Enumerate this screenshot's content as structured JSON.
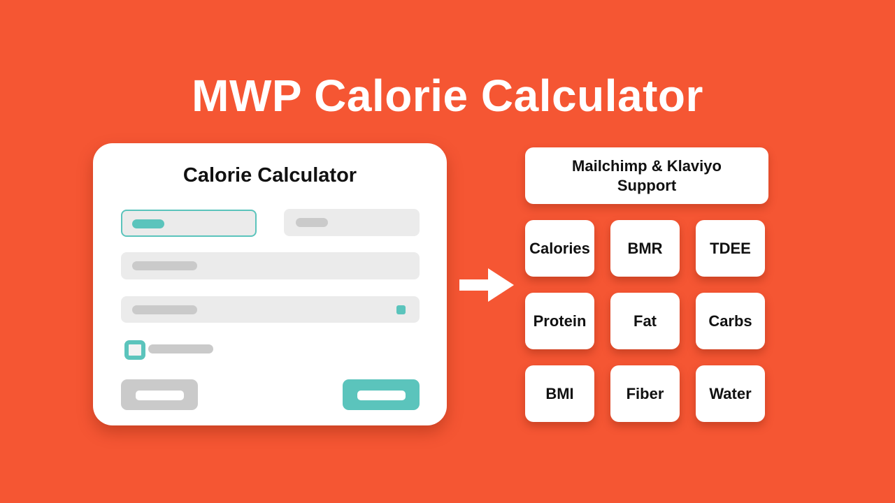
{
  "title": "MWP Calorie Calculator",
  "calculator_card": {
    "title": "Calorie Calculator"
  },
  "support_box": {
    "line1": "Mailchimp & Klaviyo",
    "line2": "Support"
  },
  "metrics": [
    "Calories",
    "BMR",
    "TDEE",
    "Protein",
    "Fat",
    "Carbs",
    "BMI",
    "Fiber",
    "Water"
  ],
  "colors": {
    "background": "#F55633",
    "accent": "#5BC4BC",
    "placeholder": "#CACACA",
    "field": "#EBEBEB"
  },
  "icons": {
    "arrow": "arrow-right-icon"
  }
}
